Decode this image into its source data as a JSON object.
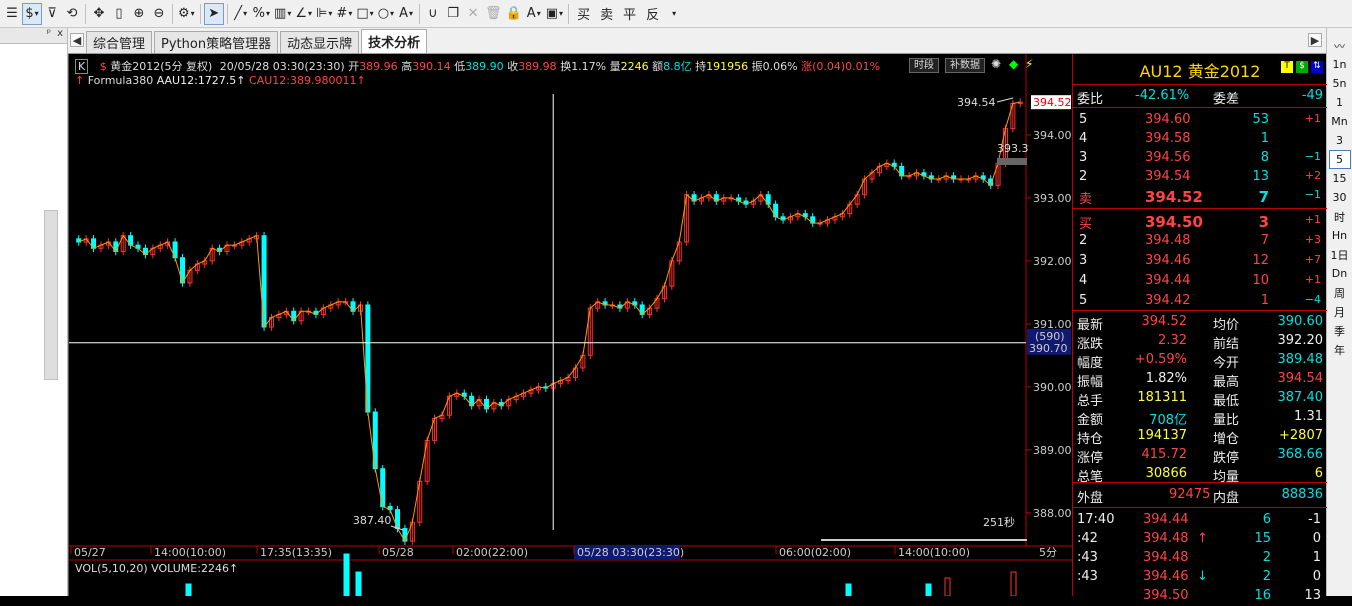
{
  "toolbar": {
    "buy": "买",
    "sell": "卖",
    "flat": "平",
    "reverse": "反"
  },
  "left_panel": {
    "pin": "ᵖ",
    "close": "x"
  },
  "tabs": [
    {
      "label": "综合管理",
      "active": false
    },
    {
      "label": "Python策略管理器",
      "active": false
    },
    {
      "label": "动态显示牌",
      "active": false
    },
    {
      "label": "技术分析",
      "active": true
    }
  ],
  "periods": [
    "1n",
    "5n",
    "1",
    "Mn",
    "3",
    "5",
    "15",
    "30",
    "时",
    "Hn",
    "1日",
    "Dn",
    "周",
    "月",
    "季",
    "年"
  ],
  "selected_period": "5",
  "info": {
    "k": "K",
    "symbol": "黄金2012",
    "cycle": "(5分 复权)",
    "datetime": "20/05/28 03:30(23:30)",
    "open_label": "开",
    "open": "389.96",
    "high_label": "高",
    "high": "390.14",
    "low_label": "低",
    "low": "389.90",
    "close_label": "收",
    "close": "389.98",
    "turnover_label": "换",
    "turnover": "1.17%",
    "vol_label": "量",
    "vol": "2246",
    "amount_label": "额",
    "amount": "8.8亿",
    "oi_label": "持",
    "oi": "191956",
    "amp_label": "振",
    "amp": "0.06%",
    "chg_label": "涨",
    "chg": "(0.04)",
    "chg_pct": "0.01%",
    "btn_time": "时段",
    "btn_fill": "补数据"
  },
  "formula": {
    "name": "Formula380",
    "s1": "AAU12:1727.5↑",
    "s2": "CAU12:389.980011↑"
  },
  "vol_title": "VOL(5,10,20) VOLUME:2246↑",
  "chart_data": {
    "type": "candlestick",
    "ylim": [
      387.6,
      394.65
    ],
    "yticks": [
      388.0,
      389.0,
      390.0,
      391.0,
      392.0,
      393.0,
      394.0
    ],
    "ytick_labels": [
      "388.00",
      "389.00",
      "390.00",
      "391.00",
      "392.00",
      "393.00",
      "394.00"
    ],
    "x_labels": [
      "05/27",
      "14:00(10:00)",
      "17:35(13:35)",
      "05/28",
      "02:00(22:00)",
      "05/28 03:30(23:30)",
      "06:00(02:00)",
      "14:00(10:00)"
    ],
    "period_label": "5分",
    "annotations": {
      "high": "394.54",
      "low": "387.40",
      "last": "393.3",
      "crosshair_price": "390.70",
      "crosshair_count": "(590)",
      "countdown": "251秒",
      "current_price": "394.52"
    },
    "closes": [
      392.3,
      392.35,
      392.2,
      392.25,
      392.3,
      392.15,
      392.4,
      392.25,
      392.2,
      392.1,
      392.2,
      392.25,
      392.3,
      392.05,
      391.65,
      391.85,
      391.95,
      392.0,
      392.2,
      392.15,
      392.25,
      392.25,
      392.3,
      392.35,
      392.4,
      390.95,
      391.1,
      391.15,
      391.2,
      391.05,
      391.2,
      391.2,
      391.15,
      391.25,
      391.3,
      391.35,
      391.35,
      391.2,
      391.3,
      389.6,
      388.7,
      388.1,
      388.05,
      387.75,
      387.55,
      387.85,
      388.5,
      389.15,
      389.5,
      389.55,
      389.85,
      389.9,
      389.85,
      389.7,
      389.8,
      389.65,
      389.75,
      389.7,
      389.8,
      389.85,
      389.9,
      389.95,
      390.0,
      389.98,
      390.05,
      390.1,
      390.15,
      390.3,
      390.5,
      391.25,
      391.35,
      391.3,
      391.3,
      391.25,
      391.35,
      391.3,
      391.15,
      391.25,
      391.4,
      391.6,
      392.0,
      392.3,
      393.05,
      392.95,
      393.0,
      393.05,
      392.95,
      393.0,
      393.0,
      392.95,
      392.9,
      392.95,
      393.05,
      392.9,
      392.7,
      392.65,
      392.7,
      392.75,
      392.7,
      392.6,
      392.6,
      392.65,
      392.7,
      392.75,
      392.9,
      393.05,
      393.3,
      393.4,
      393.5,
      393.55,
      393.5,
      393.35,
      393.35,
      393.4,
      393.35,
      393.3,
      393.3,
      393.35,
      393.3,
      393.3,
      393.3,
      393.35,
      393.3,
      393.2,
      393.55,
      394.1,
      394.5,
      394.52
    ]
  },
  "quote": {
    "code": "AU12",
    "name": "黄金2012",
    "ratio_label": "委比",
    "ratio": "-42.61%",
    "diff_label": "委差",
    "diff": "-49",
    "asks": [
      {
        "lvl": "5",
        "price": "394.60",
        "vol": "53",
        "chg": "+1"
      },
      {
        "lvl": "4",
        "price": "394.58",
        "vol": "1",
        "chg": ""
      },
      {
        "lvl": "3",
        "price": "394.56",
        "vol": "8",
        "chg": "−1"
      },
      {
        "lvl": "2",
        "price": "394.54",
        "vol": "13",
        "chg": "+2"
      },
      {
        "lvl": "卖",
        "price": "394.52",
        "vol": "7",
        "chg": "−1"
      }
    ],
    "bids": [
      {
        "lvl": "买",
        "price": "394.50",
        "vol": "3",
        "chg": "+1"
      },
      {
        "lvl": "2",
        "price": "394.48",
        "vol": "7",
        "chg": "+3"
      },
      {
        "lvl": "3",
        "price": "394.46",
        "vol": "12",
        "chg": "+7"
      },
      {
        "lvl": "4",
        "price": "394.44",
        "vol": "10",
        "chg": "+1"
      },
      {
        "lvl": "5",
        "price": "394.42",
        "vol": "1",
        "chg": "−4"
      }
    ],
    "stats": [
      {
        "l1": "最新",
        "v1": "394.52",
        "c1": "red",
        "l2": "均价",
        "v2": "390.60",
        "c2": "green"
      },
      {
        "l1": "涨跌",
        "v1": "2.32",
        "c1": "red",
        "l2": "前结",
        "v2": "392.20",
        "c2": "white"
      },
      {
        "l1": "幅度",
        "v1": "+0.59%",
        "c1": "red",
        "l2": "今开",
        "v2": "389.48",
        "c2": "green"
      },
      {
        "l1": "振幅",
        "v1": "1.82%",
        "c1": "white",
        "l2": "最高",
        "v2": "394.54",
        "c2": "red"
      },
      {
        "l1": "总手",
        "v1": "181311",
        "c1": "yellow",
        "l2": "最低",
        "v2": "387.40",
        "c2": "green"
      },
      {
        "l1": "金额",
        "v1": "708亿",
        "c1": "green",
        "l2": "量比",
        "v2": "1.31",
        "c2": "white"
      },
      {
        "l1": "持仓",
        "v1": "194137",
        "c1": "yellow",
        "l2": "增仓",
        "v2": "+2807",
        "c2": "yellow"
      },
      {
        "l1": "涨停",
        "v1": "415.72",
        "c1": "red",
        "l2": "跌停",
        "v2": "368.66",
        "c2": "green"
      },
      {
        "l1": "总笔",
        "v1": "30866",
        "c1": "yellow",
        "l2": "均量",
        "v2": "6",
        "c2": "yellow"
      }
    ],
    "outer_label": "外盘",
    "outer": "92475",
    "inner_label": "内盘",
    "inner": "88836",
    "ticks": [
      {
        "t": "17:40",
        "p": "394.44",
        "a": "",
        "v": "6",
        "d": "-1"
      },
      {
        "t": ":42",
        "p": "394.48",
        "a": "↑",
        "v": "15",
        "d": "0"
      },
      {
        "t": ":43",
        "p": "394.48",
        "a": "",
        "v": "2",
        "d": "1"
      },
      {
        "t": ":43",
        "p": "394.46",
        "a": "↓",
        "v": "2",
        "d": "0"
      },
      {
        "t": "",
        "p": "394.50",
        "a": "",
        "v": "16",
        "d": "13"
      }
    ]
  }
}
